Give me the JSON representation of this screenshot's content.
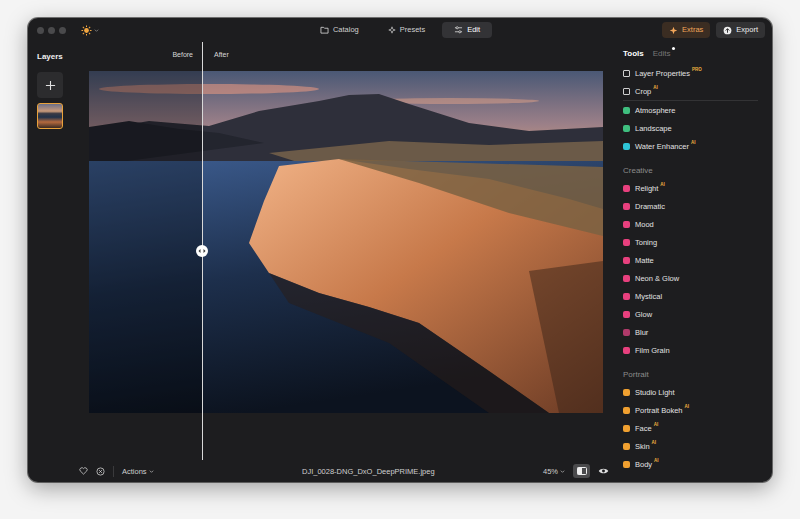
{
  "titlebar": {
    "tabs": [
      {
        "label": "Catalog",
        "selected": false
      },
      {
        "label": "Presets",
        "selected": false
      },
      {
        "label": "Edit",
        "selected": true
      }
    ],
    "extras": "Extras",
    "export": "Export"
  },
  "layers": {
    "title": "Layers",
    "thumbnails": [
      {
        "selected": true
      }
    ]
  },
  "canvas": {
    "before": "Before",
    "after": "After",
    "split": 0.22
  },
  "tools": {
    "tabs": [
      {
        "label": "Tools",
        "selected": true,
        "dot": false
      },
      {
        "label": "Edits",
        "selected": false,
        "dot": true
      }
    ],
    "pinned": [
      {
        "label": "Layer Properties",
        "badge": "PRO"
      },
      {
        "label": "Crop",
        "badge": "AI"
      }
    ],
    "items": [
      {
        "label": "Atmosphere",
        "badge": "",
        "color": "#3fbf7f"
      },
      {
        "label": "Landscape",
        "badge": "",
        "color": "#3fbf7f"
      },
      {
        "label": "Water Enhancer",
        "badge": "AI",
        "color": "#2ec4d6"
      }
    ],
    "sections": [
      {
        "title": "Creative",
        "items": [
          {
            "label": "Relight",
            "badge": "AI",
            "color": "#e8407e"
          },
          {
            "label": "Dramatic",
            "badge": "",
            "color": "#e8407e"
          },
          {
            "label": "Mood",
            "badge": "",
            "color": "#e8407e"
          },
          {
            "label": "Toning",
            "badge": "",
            "color": "#e8407e"
          },
          {
            "label": "Matte",
            "badge": "",
            "color": "#e8407e"
          },
          {
            "label": "Neon & Glow",
            "badge": "",
            "color": "#e8407e"
          },
          {
            "label": "Mystical",
            "badge": "",
            "color": "#e8407e"
          },
          {
            "label": "Glow",
            "badge": "",
            "color": "#e8407e"
          },
          {
            "label": "Blur",
            "badge": "",
            "color": "#b03a6a"
          },
          {
            "label": "Film Grain",
            "badge": "",
            "color": "#e8407e"
          }
        ]
      },
      {
        "title": "Portrait",
        "items": [
          {
            "label": "Studio Light",
            "badge": "",
            "color": "#f0a030"
          },
          {
            "label": "Portrait Bokeh",
            "badge": "AI",
            "color": "#f0a030"
          },
          {
            "label": "Face",
            "badge": "AI",
            "color": "#f0a030"
          },
          {
            "label": "Skin",
            "badge": "AI",
            "color": "#f0a030"
          },
          {
            "label": "Body",
            "badge": "AI",
            "color": "#f0a030"
          }
        ]
      }
    ]
  },
  "bottom": {
    "favorite": false,
    "actions": "Actions",
    "filename": "DJI_0028-DNG_DxO_DeepPRIME.jpeg",
    "zoom": "45%",
    "compare": true
  }
}
